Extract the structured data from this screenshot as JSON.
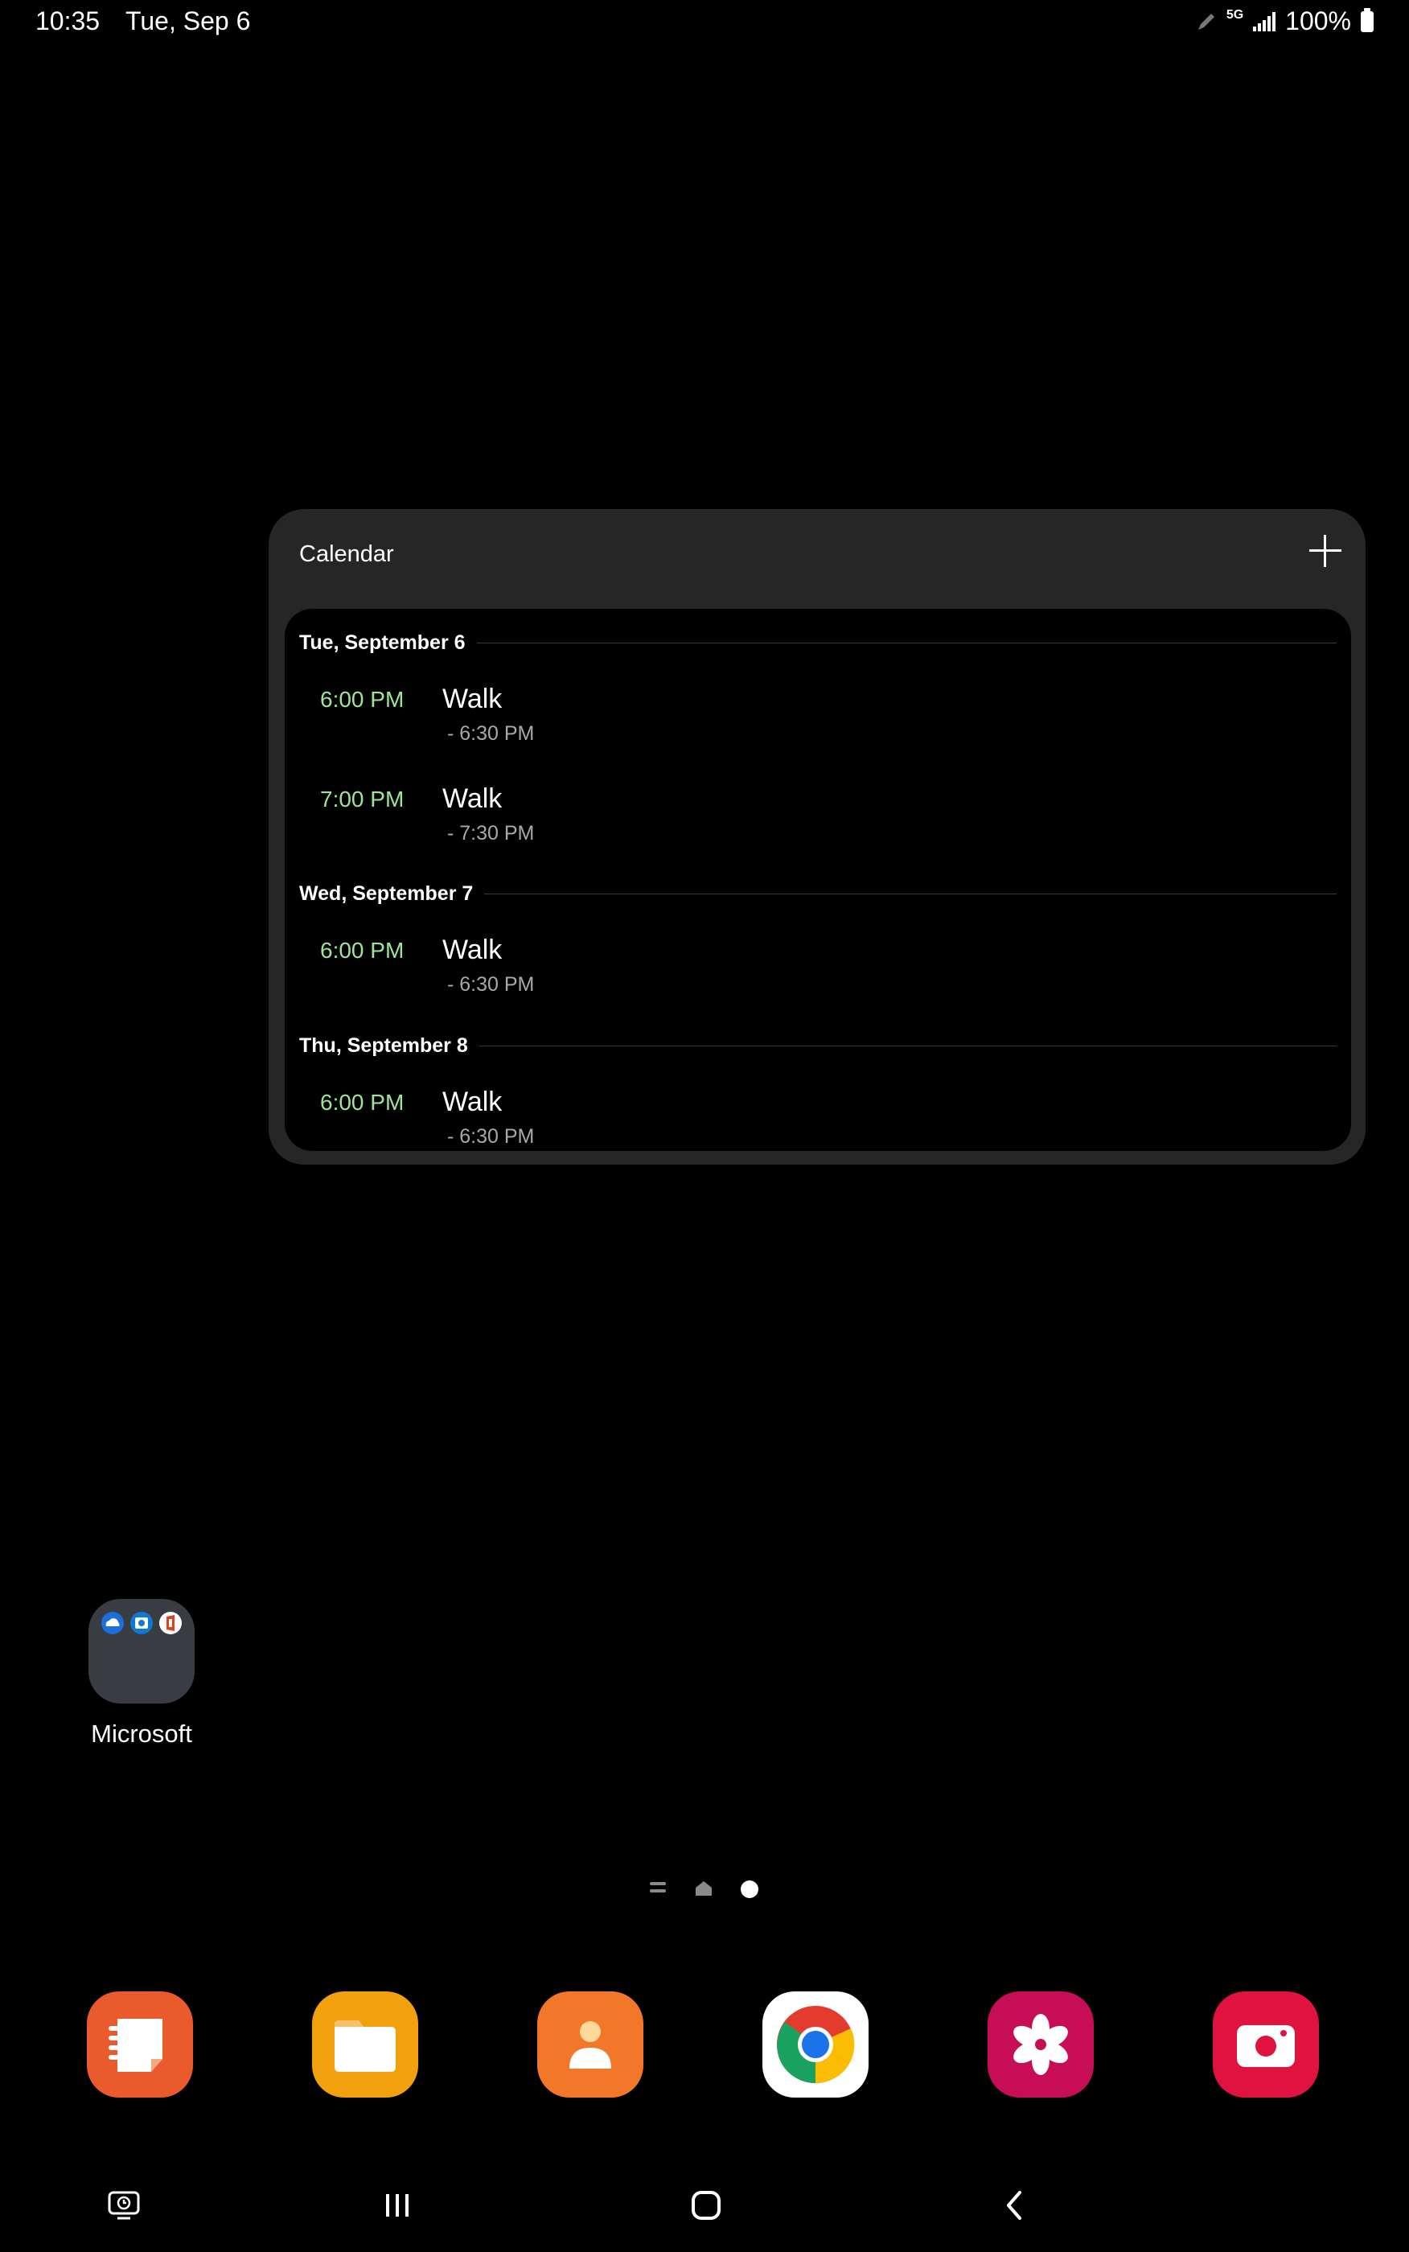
{
  "status_bar": {
    "time": "10:35",
    "date": "Tue, Sep 6",
    "network": "5G",
    "battery": "100%"
  },
  "calendar_widget": {
    "title": "Calendar",
    "days": [
      {
        "header": "Tue, September 6",
        "events": [
          {
            "start": "6:00 PM",
            "title": "Walk",
            "end": "- 6:30 PM"
          },
          {
            "start": "7:00 PM",
            "title": "Walk",
            "end": "- 7:30 PM"
          }
        ]
      },
      {
        "header": "Wed, September 7",
        "events": [
          {
            "start": "6:00 PM",
            "title": "Walk",
            "end": "- 6:30 PM"
          }
        ]
      },
      {
        "header": "Thu, September 8",
        "events": [
          {
            "start": "6:00 PM",
            "title": "Walk",
            "end": "- 6:30 PM"
          }
        ]
      }
    ]
  },
  "folder": {
    "label": "Microsoft",
    "apps": [
      "onedrive-icon",
      "outlook-icon",
      "office-icon"
    ]
  },
  "pager": {
    "pages": [
      "list-icon",
      "home-icon",
      "dot"
    ],
    "active": 2
  },
  "dock": [
    "samsung-notes-icon",
    "my-files-icon",
    "contacts-icon",
    "chrome-icon",
    "gallery-icon",
    "camera-icon"
  ],
  "nav": [
    "screen-time-icon",
    "recents-button",
    "home-button",
    "back-button"
  ],
  "colors": {
    "event_time": "#9ee59a",
    "widget_bg": "#262626"
  }
}
